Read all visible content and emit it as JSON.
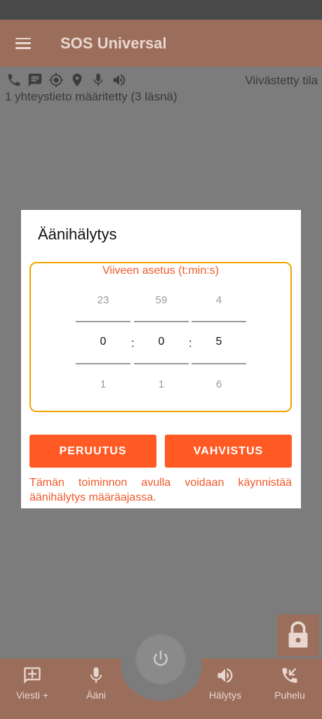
{
  "app": {
    "title": "SOS Universal"
  },
  "status": {
    "mode_label": "Viivästetty tila",
    "contacts_text": "1 yhteystieto määritetty (3 läsnä)",
    "icons": [
      "phone-icon",
      "message-icon",
      "gps-target-icon",
      "location-pin-icon",
      "microphone-icon",
      "speaker-icon"
    ]
  },
  "dialog": {
    "title": "Äänihälytys",
    "picker_caption": "Viiveen asetus (t:min:s)",
    "hours": {
      "prev": "23",
      "current": "0",
      "next": "1"
    },
    "minutes": {
      "prev": "59",
      "current": "0",
      "next": "1"
    },
    "seconds": {
      "prev": "4",
      "current": "5",
      "next": "6"
    },
    "separator": ":",
    "cancel_label": "PERUUTUS",
    "confirm_label": "VAHVISTUS",
    "description": "Tämän toiminnon avulla voidaan käynnistää äänihälytys määräajassa."
  },
  "bottom_nav": {
    "items": [
      {
        "label": "Viesti +",
        "icon": "add-message-icon"
      },
      {
        "label": "Ääni",
        "icon": "microphone-icon"
      },
      {
        "label": "Hälytys",
        "icon": "speaker-icon"
      },
      {
        "label": "Puhelu",
        "icon": "incoming-call-icon"
      }
    ],
    "center_icon": "power-icon"
  },
  "colors": {
    "accent": "#ff5a24",
    "picker_border": "#f2a300",
    "appbar_dimmed": "#9b6d5b"
  }
}
